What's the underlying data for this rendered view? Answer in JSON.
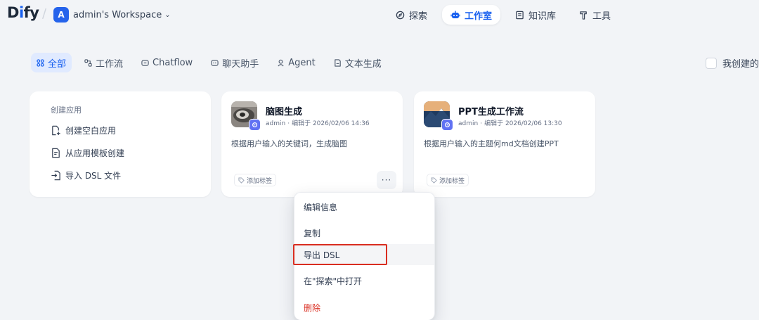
{
  "brand": {
    "logo_prefix": "D",
    "logo_i": "i",
    "logo_suffix": "fy"
  },
  "workspace": {
    "avatar_letter": "A",
    "name": "admin's Workspace"
  },
  "nav": {
    "explore": "探索",
    "studio": "工作室",
    "knowledge": "知识库",
    "tools": "工具"
  },
  "filters": {
    "all": "全部",
    "workflow": "工作流",
    "chatflow": "Chatflow",
    "chatbot": "聊天助手",
    "agent": "Agent",
    "completion": "文本生成",
    "created_by_me": "我创建的"
  },
  "create_card": {
    "title": "创建应用",
    "blank": "创建空白应用",
    "from_template": "从应用模板创建",
    "import_dsl": "导入 DSL 文件"
  },
  "apps": [
    {
      "name": "脑图生成",
      "author": "admin",
      "edited": "编辑于 2026/02/06 14:36",
      "description": "根据用户输入的关键词，生成脑图",
      "tag_label": "添加标签"
    },
    {
      "name": "PPT生成工作流",
      "author": "admin",
      "edited": "编辑于 2026/02/06 13:30",
      "description": "根据用户输入的主题何md文档创建PPT",
      "tag_label": "添加标签"
    }
  ],
  "context_menu": {
    "edit_info": "编辑信息",
    "duplicate": "复制",
    "export_dsl": "导出 DSL",
    "open_in_explore": "在\"探索\"中打开",
    "delete": "删除"
  },
  "colors": {
    "accent": "#155eef",
    "danger": "#d92d20",
    "highlight_border": "#d92d20"
  }
}
